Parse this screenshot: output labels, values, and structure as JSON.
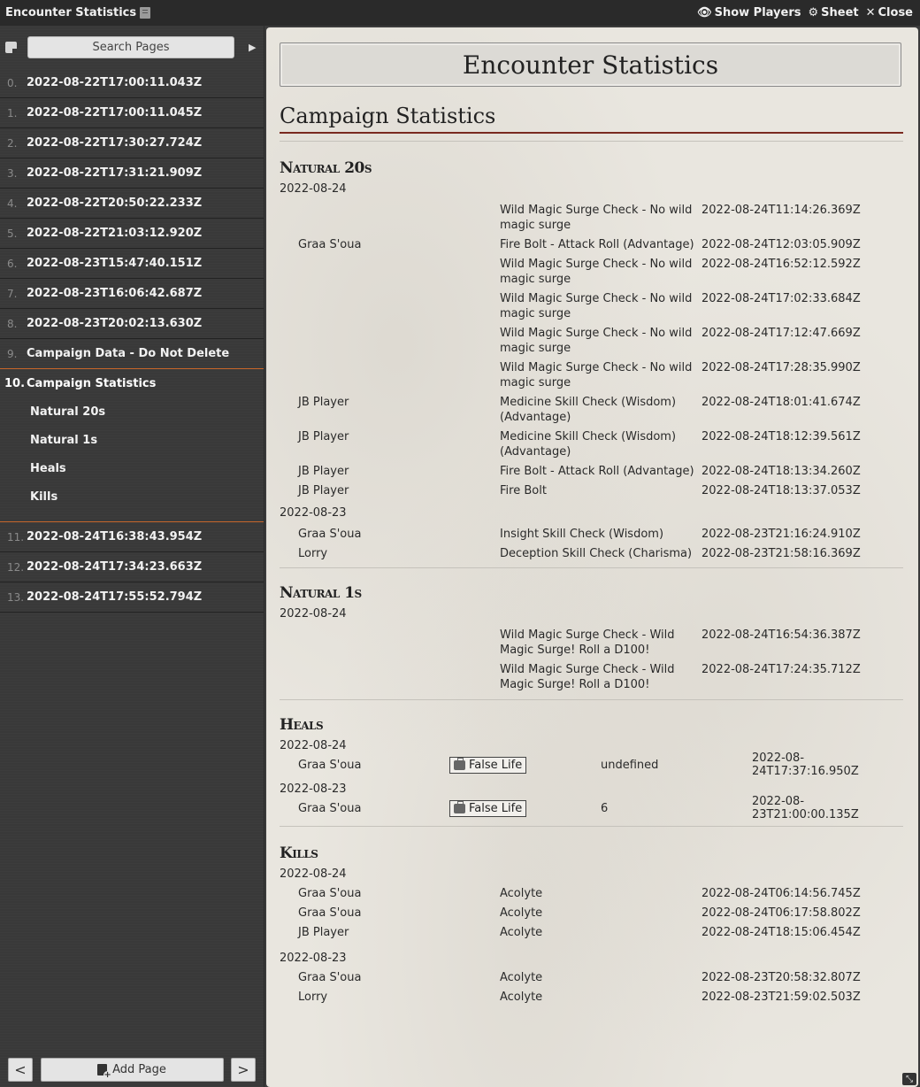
{
  "window": {
    "title": "Encounter Statistics",
    "actions": [
      {
        "icon": "eye-icon",
        "label": "Show Players"
      },
      {
        "icon": "gear-icon",
        "label": "Sheet"
      },
      {
        "icon": "close-icon",
        "label": "Close"
      }
    ]
  },
  "sidebar": {
    "search_placeholder": "Search Pages",
    "pages_before": [
      {
        "idx": "0.",
        "label": "2022-08-22T17:00:11.043Z"
      },
      {
        "idx": "1.",
        "label": "2022-08-22T17:00:11.045Z"
      },
      {
        "idx": "2.",
        "label": "2022-08-22T17:30:27.724Z"
      },
      {
        "idx": "3.",
        "label": "2022-08-22T17:31:21.909Z"
      },
      {
        "idx": "4.",
        "label": "2022-08-22T20:50:22.233Z"
      },
      {
        "idx": "5.",
        "label": "2022-08-22T21:03:12.920Z"
      },
      {
        "idx": "6.",
        "label": "2022-08-23T15:47:40.151Z"
      },
      {
        "idx": "7.",
        "label": "2022-08-23T16:06:42.687Z"
      },
      {
        "idx": "8.",
        "label": "2022-08-23T20:02:13.630Z"
      },
      {
        "idx": "9.",
        "label": "Campaign Data - Do Not Delete"
      }
    ],
    "active": {
      "idx": "10.",
      "label": "Campaign Statistics",
      "subitems": [
        "Natural 20s",
        "Natural 1s",
        "Heals",
        "Kills"
      ]
    },
    "pages_after": [
      {
        "idx": "11.",
        "label": "2022-08-24T16:38:43.954Z"
      },
      {
        "idx": "12.",
        "label": "2022-08-24T17:34:23.663Z"
      },
      {
        "idx": "13.",
        "label": "2022-08-24T17:55:52.794Z"
      }
    ],
    "add_page_label": "Add Page",
    "prev_label": "<",
    "next_label": ">"
  },
  "doc": {
    "title": "Encounter Statistics",
    "heading": "Campaign Statistics",
    "natural20s": {
      "title": "Natural 20s",
      "groups": [
        {
          "date": "2022-08-24",
          "rows": [
            {
              "who": "",
              "what": "Wild Magic Surge Check - No wild magic surge",
              "when": "2022-08-24T11:14:26.369Z"
            },
            {
              "who": "Graa S'oua",
              "what": "Fire Bolt - Attack Roll (Advantage)",
              "when": "2022-08-24T12:03:05.909Z"
            },
            {
              "who": "",
              "what": "Wild Magic Surge Check - No wild magic surge",
              "when": "2022-08-24T16:52:12.592Z"
            },
            {
              "who": "",
              "what": "Wild Magic Surge Check - No wild magic surge",
              "when": "2022-08-24T17:02:33.684Z"
            },
            {
              "who": "",
              "what": "Wild Magic Surge Check - No wild magic surge",
              "when": "2022-08-24T17:12:47.669Z"
            },
            {
              "who": "",
              "what": "Wild Magic Surge Check - No wild magic surge",
              "when": "2022-08-24T17:28:35.990Z"
            },
            {
              "who": "JB Player",
              "what": "Medicine Skill Check (Wisdom) (Advantage)",
              "when": "2022-08-24T18:01:41.674Z"
            },
            {
              "who": "JB Player",
              "what": "Medicine Skill Check (Wisdom) (Advantage)",
              "when": "2022-08-24T18:12:39.561Z"
            },
            {
              "who": "JB Player",
              "what": "Fire Bolt - Attack Roll (Advantage)",
              "when": "2022-08-24T18:13:34.260Z"
            },
            {
              "who": "JB Player",
              "what": "Fire Bolt",
              "when": "2022-08-24T18:13:37.053Z"
            }
          ]
        },
        {
          "date": "2022-08-23",
          "rows": [
            {
              "who": "Graa S'oua",
              "what": "Insight Skill Check (Wisdom)",
              "when": "2022-08-23T21:16:24.910Z"
            },
            {
              "who": "Lorry",
              "what": "Deception Skill Check (Charisma)",
              "when": "2022-08-23T21:58:16.369Z"
            }
          ]
        }
      ]
    },
    "natural1s": {
      "title": "Natural 1s",
      "groups": [
        {
          "date": "2022-08-24",
          "rows": [
            {
              "who": "",
              "what": "Wild Magic Surge Check - Wild Magic Surge! Roll a D100!",
              "when": "2022-08-24T16:54:36.387Z"
            },
            {
              "who": "",
              "what": "Wild Magic Surge Check - Wild Magic Surge! Roll a D100!",
              "when": "2022-08-24T17:24:35.712Z"
            }
          ]
        }
      ]
    },
    "heals": {
      "title": "Heals",
      "groups": [
        {
          "date": "2022-08-24",
          "rows": [
            {
              "who": "Graa S'oua",
              "spell": "False Life",
              "amount": "undefined",
              "when": "2022-08-24T17:37:16.950Z"
            }
          ]
        },
        {
          "date": "2022-08-23",
          "rows": [
            {
              "who": "Graa S'oua",
              "spell": "False Life",
              "amount": "6",
              "when": "2022-08-23T21:00:00.135Z"
            }
          ]
        }
      ]
    },
    "kills": {
      "title": "Kills",
      "groups": [
        {
          "date": "2022-08-24",
          "rows": [
            {
              "who": "Graa S'oua",
              "what": "Acolyte",
              "when": "2022-08-24T06:14:56.745Z"
            },
            {
              "who": "Graa S'oua",
              "what": "Acolyte",
              "when": "2022-08-24T06:17:58.802Z"
            },
            {
              "who": "JB Player",
              "what": "Acolyte",
              "when": "2022-08-24T18:15:06.454Z"
            }
          ]
        },
        {
          "date": "2022-08-23",
          "rows": [
            {
              "who": "Graa S'oua",
              "what": "Acolyte",
              "when": "2022-08-23T20:58:32.807Z"
            },
            {
              "who": "Lorry",
              "what": "Acolyte",
              "when": "2022-08-23T21:59:02.503Z"
            }
          ]
        }
      ]
    }
  },
  "colors": {
    "accent": "#c8662a",
    "heading_rule": "#7a2a20",
    "paper": "#e9e6df",
    "sidebar": "#393939"
  }
}
